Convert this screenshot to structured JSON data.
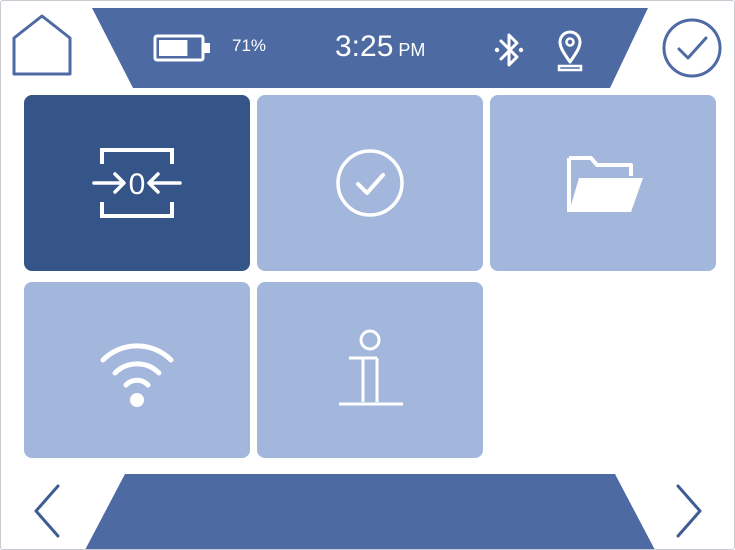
{
  "status_bar": {
    "battery_percent": "71%",
    "battery_level": 0.71,
    "time": "3:25",
    "am_pm": "PM"
  },
  "icons": {
    "home": "home-icon",
    "confirm": "checkmark-circle-icon",
    "battery": "battery-icon",
    "bluetooth": "bluetooth-icon",
    "location": "location-pin-icon",
    "zero": "zero-calibration-icon",
    "timer": "clock-check-icon",
    "files": "folder-icon",
    "wifi": "wifi-icon",
    "info": "info-icon",
    "prev": "chevron-left-icon",
    "next": "chevron-right-icon"
  },
  "tiles": [
    {
      "id": "zero",
      "icon": "zero-calibration-icon",
      "label": "0",
      "selected": true
    },
    {
      "id": "timer",
      "icon": "clock-check-icon",
      "selected": false
    },
    {
      "id": "files",
      "icon": "folder-icon",
      "selected": false
    },
    {
      "id": "wifi",
      "icon": "wifi-icon",
      "selected": false
    },
    {
      "id": "info",
      "icon": "info-icon",
      "selected": false
    }
  ],
  "colors": {
    "primary_dark": "#355588",
    "tile_light": "#a3b6dc",
    "bar": "#4e6aa3",
    "icon_line": "#3e5b94",
    "background": "#ffffff"
  }
}
